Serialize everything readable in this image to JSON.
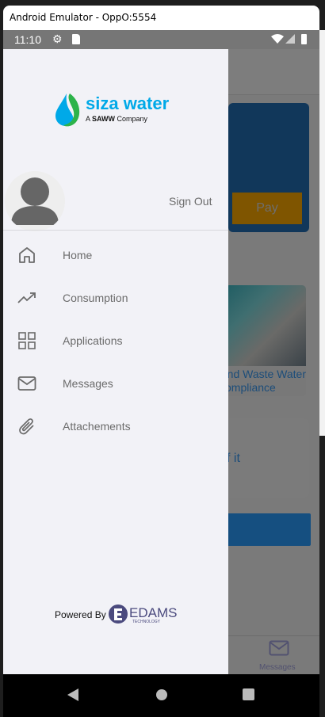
{
  "window": {
    "title": "Android Emulator - OppO:5554"
  },
  "status_bar": {
    "time": "11:10",
    "icons": [
      "gear-icon",
      "sd-card-icon",
      "wifi-icon",
      "signal-icon",
      "battery-icon"
    ]
  },
  "background": {
    "pay_label": "Pay",
    "card_text_line1": "nd Waste Water",
    "card_text_line2": "ompliance",
    "card2_text": "f it",
    "bottom_nav_label": "Messages"
  },
  "drawer": {
    "logo": {
      "brand": "siza water",
      "tagline": "A SAWW Company"
    },
    "sign_out": "Sign Out",
    "items": [
      {
        "label": "Home",
        "icon": "home-icon"
      },
      {
        "label": "Consumption",
        "icon": "trending-up-icon"
      },
      {
        "label": "Applications",
        "icon": "grid-icon"
      },
      {
        "label": "Messages",
        "icon": "mail-icon"
      },
      {
        "label": "Attachements",
        "icon": "paperclip-icon"
      }
    ],
    "powered_by": "Powered By",
    "powered_logo": {
      "name": "EDAMS",
      "sub": "TECHNOLOGY"
    }
  },
  "colors": {
    "drawer_bg": "#f2f2f7",
    "brand_blue": "#00a9e8",
    "brand_green": "#2db34a",
    "icon_gray": "#6b6b6b"
  }
}
